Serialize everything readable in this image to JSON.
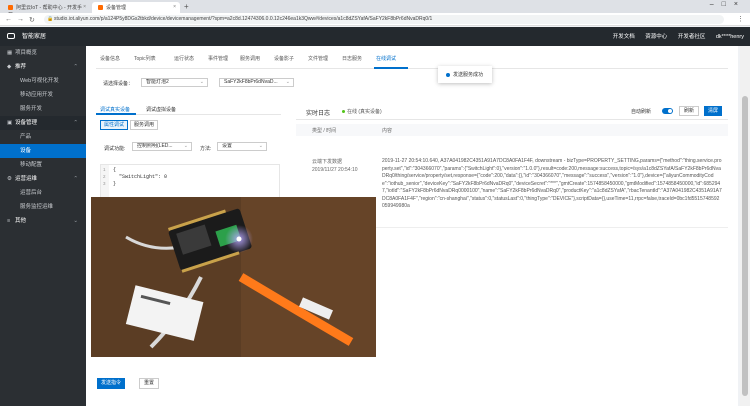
{
  "browser": {
    "tabs": [
      {
        "label": "阿里云IoT - 帮助中心 - 开发手册"
      },
      {
        "label": "设备管理"
      }
    ],
    "url": "studio.iot.aliyun.com/p/a124P5y8DGs2tbkd/device/devicemanagement/?spm=a2c8d.12474306.0.0.12c246ea1k3Qww#/devices/a1c8dZSYafA/SaFY2kF8bPr6dNvaDRq0/1"
  },
  "header": {
    "app_name": "智能家居",
    "nav": [
      "开发文档",
      "资源中心",
      "开发者社区",
      "dk****henry"
    ]
  },
  "sidebar": {
    "items": [
      {
        "label": "项目概览",
        "icon": "grid-icon"
      },
      {
        "label": "推荐",
        "icon": "thumb-icon",
        "group": true
      },
      {
        "label": "Web可视化开发",
        "sub": true
      },
      {
        "label": "移动应用开发",
        "sub": true
      },
      {
        "label": "服务开发",
        "sub": true
      },
      {
        "label": "设备管理",
        "icon": "device-icon",
        "group": true,
        "active_group": true
      },
      {
        "label": "产品",
        "sub": true
      },
      {
        "label": "设备",
        "sub": true,
        "active": true
      },
      {
        "label": "移动配置",
        "sub": true
      },
      {
        "label": "运营运维",
        "icon": "ops-icon",
        "group": true
      },
      {
        "label": "运营后台",
        "sub": true
      },
      {
        "label": "服务监控运维",
        "sub": true
      },
      {
        "label": "其他",
        "icon": "more-icon",
        "group": true
      }
    ]
  },
  "main": {
    "tabs": [
      "设备信息",
      "Topic列表",
      "运行状态",
      "事件管理",
      "服务调用",
      "设备影子",
      "文件管理",
      "日志服务",
      "在线调试"
    ],
    "active_tab": "在线调试",
    "tooltip": "发送服务成功",
    "device_label": "请选择设备：",
    "device_product": "智能灯泡2",
    "device_name": "SaFY2kF8bPr6dNvaD..."
  },
  "left_panel": {
    "tabs": [
      "调试真实设备",
      "调试虚拟设备"
    ],
    "sub_buttons": [
      "属性调试",
      "服务调用"
    ],
    "func_label": "调试功能:",
    "func_value": "控制照明(LED...",
    "method_label": "方法:",
    "method_value": "设置",
    "code_lines": [
      "{",
      "  \"SwitchLight\": 0",
      "}"
    ],
    "send_label": "发送指令",
    "reset_label": "重置"
  },
  "right_panel": {
    "title": "实时日志",
    "status": "在线 (真实设备)",
    "auto_refresh": "自动刷新",
    "refresh_btn": "刷新",
    "clear_btn": "清屏",
    "col_type": "类型 / 时间",
    "col_content": "内容",
    "entry_type": "云端下发数据",
    "entry_time": "2019/11/27 20:54:10",
    "entry_content": "2019-11-27 20:54:10.640, A37A041982C4351A91A7DC8A0FA1F4F, downstream - bizType=PROPERTY_SETTING,params={\"method\":\"thing.service.property.set\",\"id\":\"304366070\",\"params\":{\"SwitchLight\":0},\"version\":\"1.0.0\"},result=code:200,message:success,topic=/sys/a1c8dZSYafA/SaFY2kF8bPr6dNvaDRq0/thing/service/property/set,response={\"code\":200,\"data\":{},\"id\":\"304366070\",\"message\":\"success\",\"version\":\"1.0\"},device={\"aliyunCommodityCode\":\"iothub_senior\",\"deviceKey\":\"SaFY2kF8bPr6dNvaDRq0\",\"deviceSecret\":\"***\",\"gmtCreate\":1574858450000,\"gmtModified\":1574858450000,\"id\":6852947,\"iotId\":\"SaFY2kF8bPr6dNvaDRq0000100\",\"name\":\"SaFY2kF8bPr6dNvaDRq0\",\"productKey\":\"a1c8dZSYafA\",\"rbacTenantId\":\"A37A041982C4351A91A7DC8A0FA1F4F\",\"region\":\"cn-shanghai\",\"status\":0,\"statusLast\":0,\"thingType\":\"DEVICE\"},scriptData={},useTime=11,rrpc=false,traceId=0bc1fd5515748592059949980a"
  },
  "colors": {
    "accent": "#0070cc",
    "header_bg": "#24292e",
    "sidebar_bg": "#2b2f33"
  }
}
